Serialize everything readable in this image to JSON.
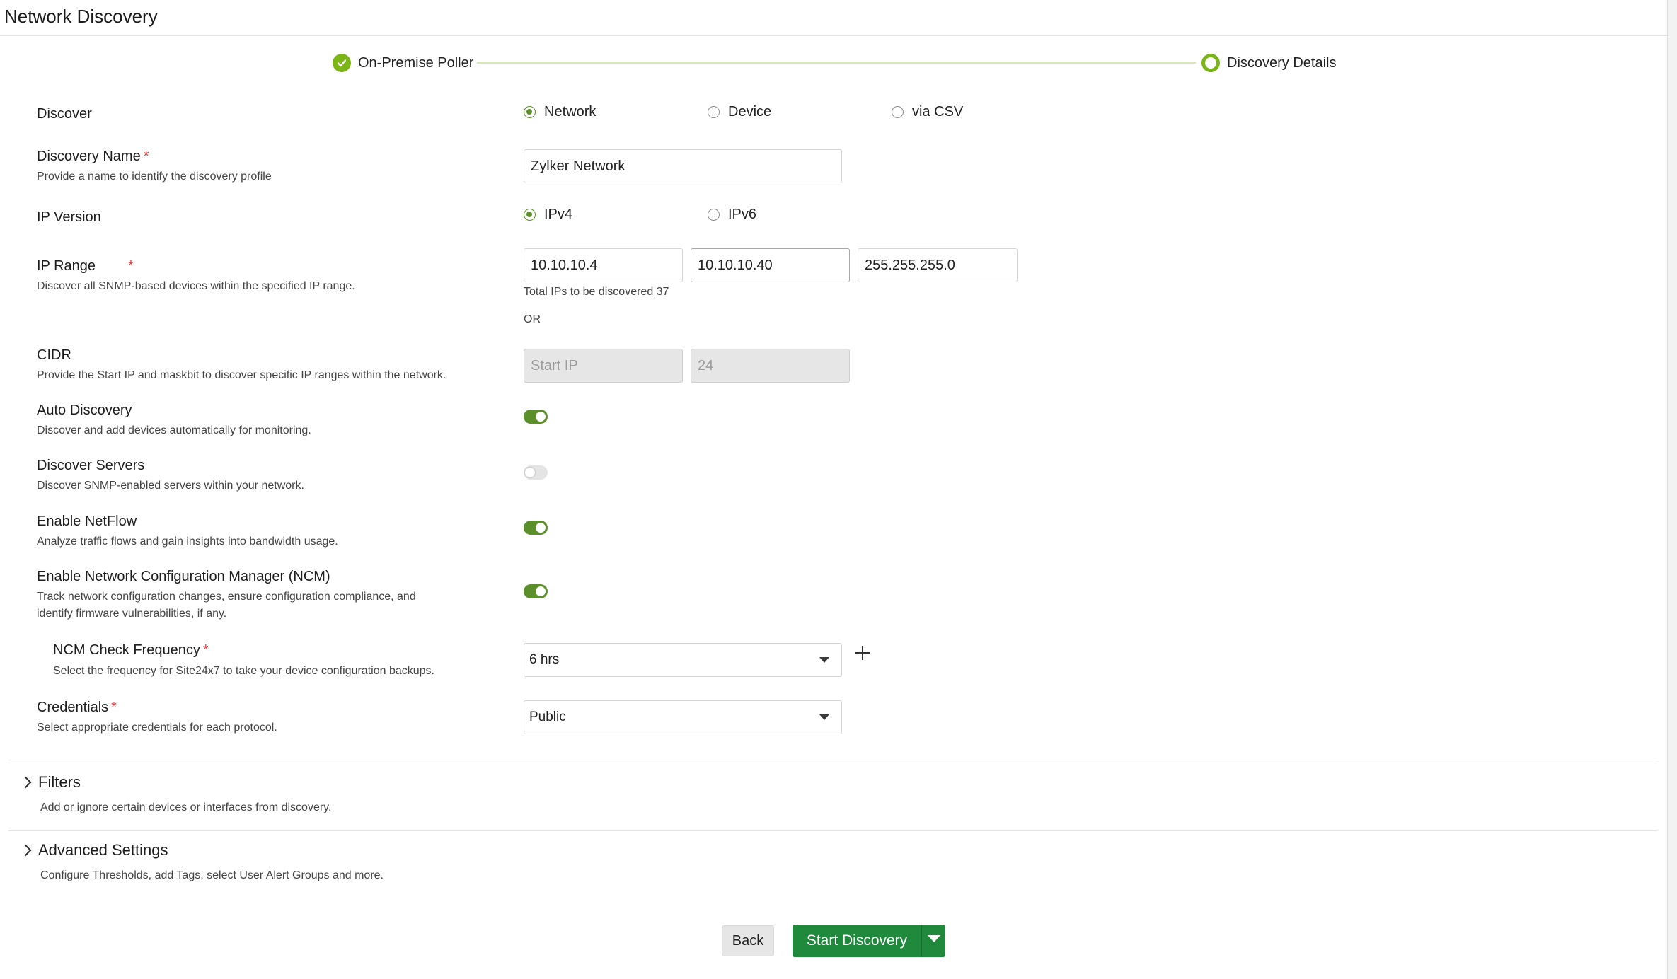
{
  "page": {
    "title": "Network Discovery"
  },
  "stepper": {
    "step1": "On-Premise Poller",
    "step2": "Discovery Details",
    "accent": "#7cb518"
  },
  "discover": {
    "label": "Discover",
    "options": [
      "Network",
      "Device",
      "via CSV"
    ],
    "selected": "Network"
  },
  "discovery_name": {
    "label": "Discovery Name",
    "desc": "Provide a name to identify the discovery profile",
    "value": "Zylker Network"
  },
  "ip_version": {
    "label": "IP Version",
    "options": [
      "IPv4",
      "IPv6"
    ],
    "selected": "IPv4"
  },
  "ip_range": {
    "label": "IP Range",
    "desc": "Discover all SNMP-based devices within the specified IP range.",
    "start": "10.10.10.4",
    "end": "10.10.10.40",
    "mask": "255.255.255.0",
    "total_note": "Total IPs to be discovered 37",
    "or_text": "OR"
  },
  "cidr": {
    "label": "CIDR",
    "desc": "Provide the Start IP and maskbit to discover specific IP ranges within the network.",
    "start_placeholder": "Start IP",
    "maskbit_placeholder": "24"
  },
  "auto_discovery": {
    "label": "Auto Discovery",
    "desc": "Discover and add devices automatically for monitoring.",
    "enabled": true
  },
  "discover_servers": {
    "label": "Discover Servers",
    "desc": "Discover SNMP-enabled servers within your network.",
    "enabled": false
  },
  "netflow": {
    "label": "Enable NetFlow",
    "desc": "Analyze traffic flows and gain insights into bandwidth usage.",
    "enabled": true
  },
  "ncm": {
    "label": "Enable Network Configuration Manager (NCM)",
    "desc_line1": "Track network configuration changes, ensure configuration compliance, and",
    "desc_line2": "identify firmware vulnerabilities, if any.",
    "enabled": true
  },
  "ncm_frequency": {
    "label": "NCM Check Frequency",
    "desc": "Select the frequency for Site24x7 to take your device configuration backups.",
    "value": "6 hrs"
  },
  "credentials": {
    "label": "Credentials",
    "desc": "Select appropriate credentials for each protocol.",
    "value": "Public"
  },
  "filters": {
    "title": "Filters",
    "desc": "Add or ignore certain devices or interfaces from discovery."
  },
  "advanced": {
    "title": "Advanced Settings",
    "desc": "Configure Thresholds, add Tags, select User Alert Groups and more."
  },
  "actions": {
    "back": "Back",
    "start": "Start Discovery",
    "primary_color": "#1f8a3c",
    "toggle_color": "#5b8f29"
  }
}
